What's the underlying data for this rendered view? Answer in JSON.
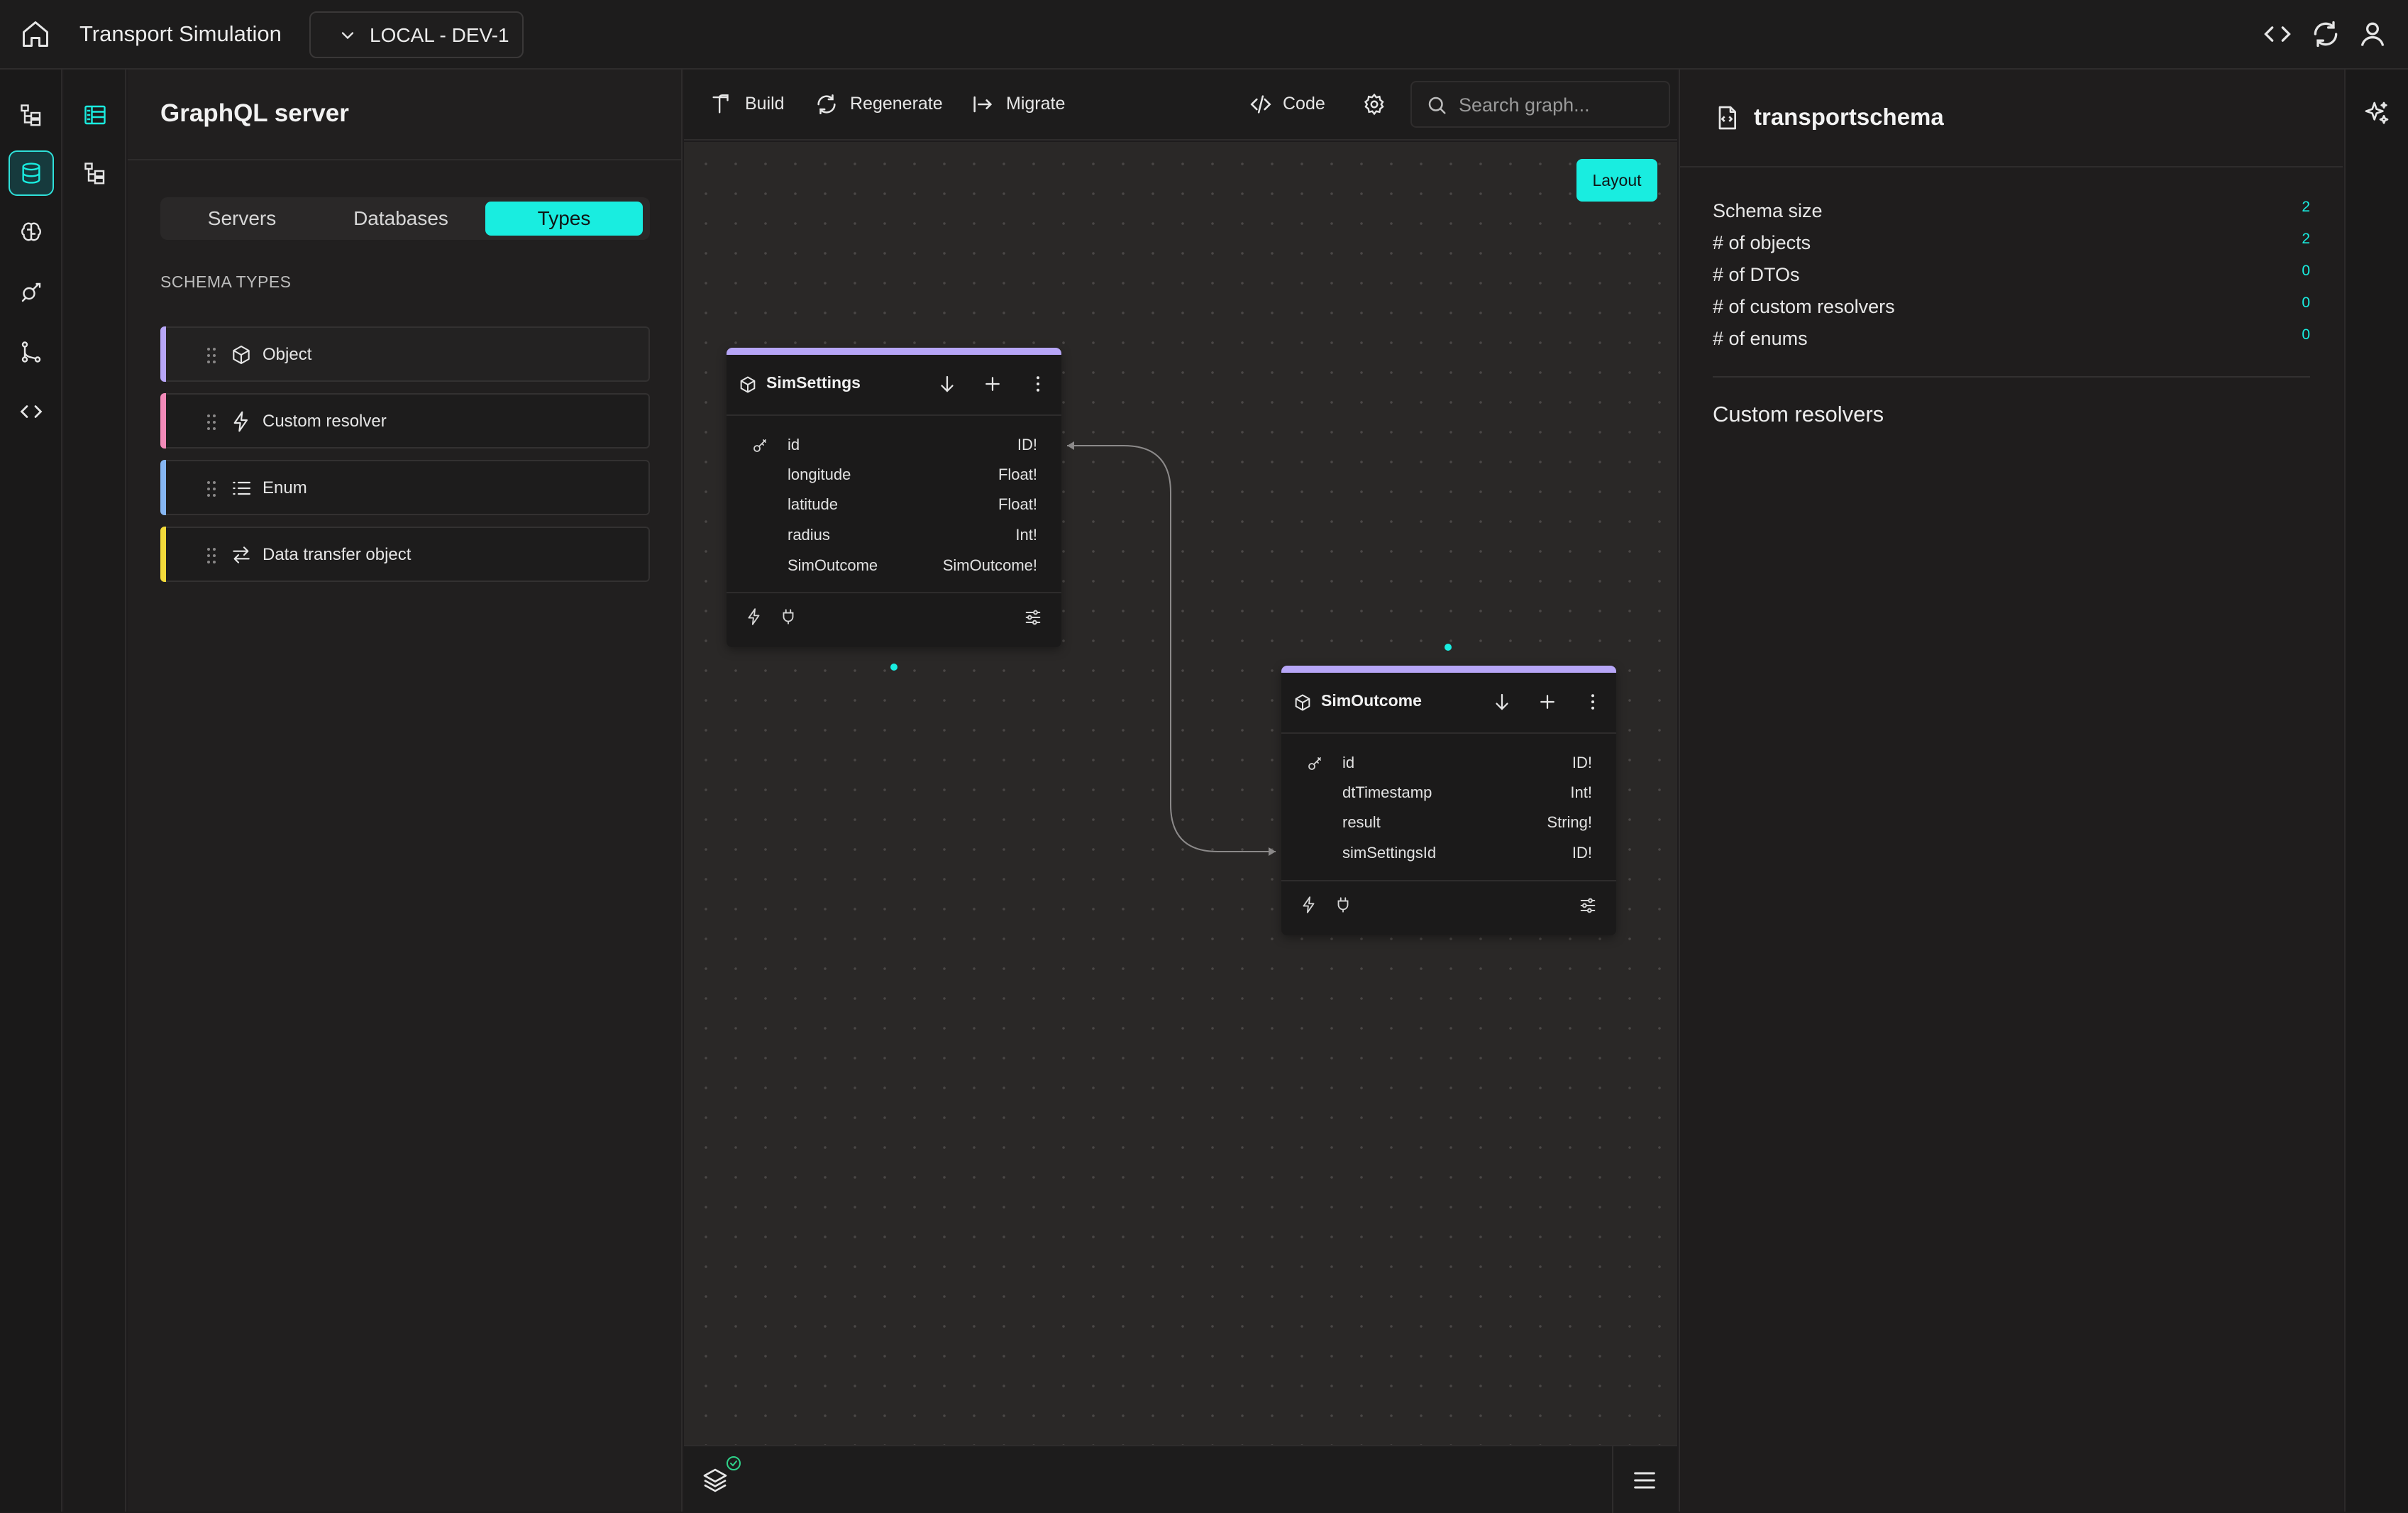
{
  "app": {
    "title": "Transport Simulation",
    "environment": "LOCAL - DEV-1",
    "accent_color": "#19ede0"
  },
  "topbar_icons": [
    "home-icon",
    "code-icon",
    "refresh-icon",
    "user-icon"
  ],
  "rail": {
    "items": [
      "tree-icon",
      "database-icon",
      "brain-icon",
      "api-icon",
      "branch-icon",
      "code-icon"
    ],
    "active": "database-icon"
  },
  "rail2": {
    "items": [
      "dashboard-icon",
      "hierarchy-icon"
    ]
  },
  "panel": {
    "title": "GraphQL server",
    "tabs": [
      {
        "label": "Servers",
        "active": false
      },
      {
        "label": "Databases",
        "active": false
      },
      {
        "label": "Types",
        "active": true
      }
    ],
    "section_heading": "SCHEMA TYPES",
    "schema_types": [
      {
        "label": "Object",
        "icon": "cube-icon",
        "color": "#b7a6f7"
      },
      {
        "label": "Custom resolver",
        "icon": "bolt-icon",
        "color": "#f28ab8"
      },
      {
        "label": "Enum",
        "icon": "list-icon",
        "color": "#86b6f2"
      },
      {
        "label": "Data transfer object",
        "icon": "transfer-icon",
        "color": "#f2d93a"
      }
    ]
  },
  "toolbar": {
    "build": "Build",
    "regenerate": "Regenerate",
    "migrate": "Migrate",
    "code": "Code",
    "search_placeholder": "Search graph..."
  },
  "canvas": {
    "layout_button": "Layout",
    "nodes": [
      {
        "id": "sim-settings",
        "title": "SimSettings",
        "fields": [
          {
            "name": "id",
            "type": "ID!",
            "key": true
          },
          {
            "name": "longitude",
            "type": "Float!"
          },
          {
            "name": "latitude",
            "type": "Float!"
          },
          {
            "name": "radius",
            "type": "Int!"
          },
          {
            "name": "SimOutcome",
            "type": "SimOutcome!"
          }
        ]
      },
      {
        "id": "sim-outcome",
        "title": "SimOutcome",
        "fields": [
          {
            "name": "id",
            "type": "ID!",
            "key": true
          },
          {
            "name": "dtTimestamp",
            "type": "Int!"
          },
          {
            "name": "result",
            "type": "String!"
          },
          {
            "name": "simSettingsId",
            "type": "ID!"
          }
        ]
      }
    ]
  },
  "right_panel": {
    "title": "transportschema",
    "stats": [
      {
        "label": "Schema size",
        "value": "2"
      },
      {
        "label": "# of objects",
        "value": "2"
      },
      {
        "label": "# of DTOs",
        "value": "0"
      },
      {
        "label": "# of custom resolvers",
        "value": "0"
      },
      {
        "label": "# of enums",
        "value": "0"
      }
    ],
    "custom_resolvers_heading": "Custom resolvers"
  }
}
